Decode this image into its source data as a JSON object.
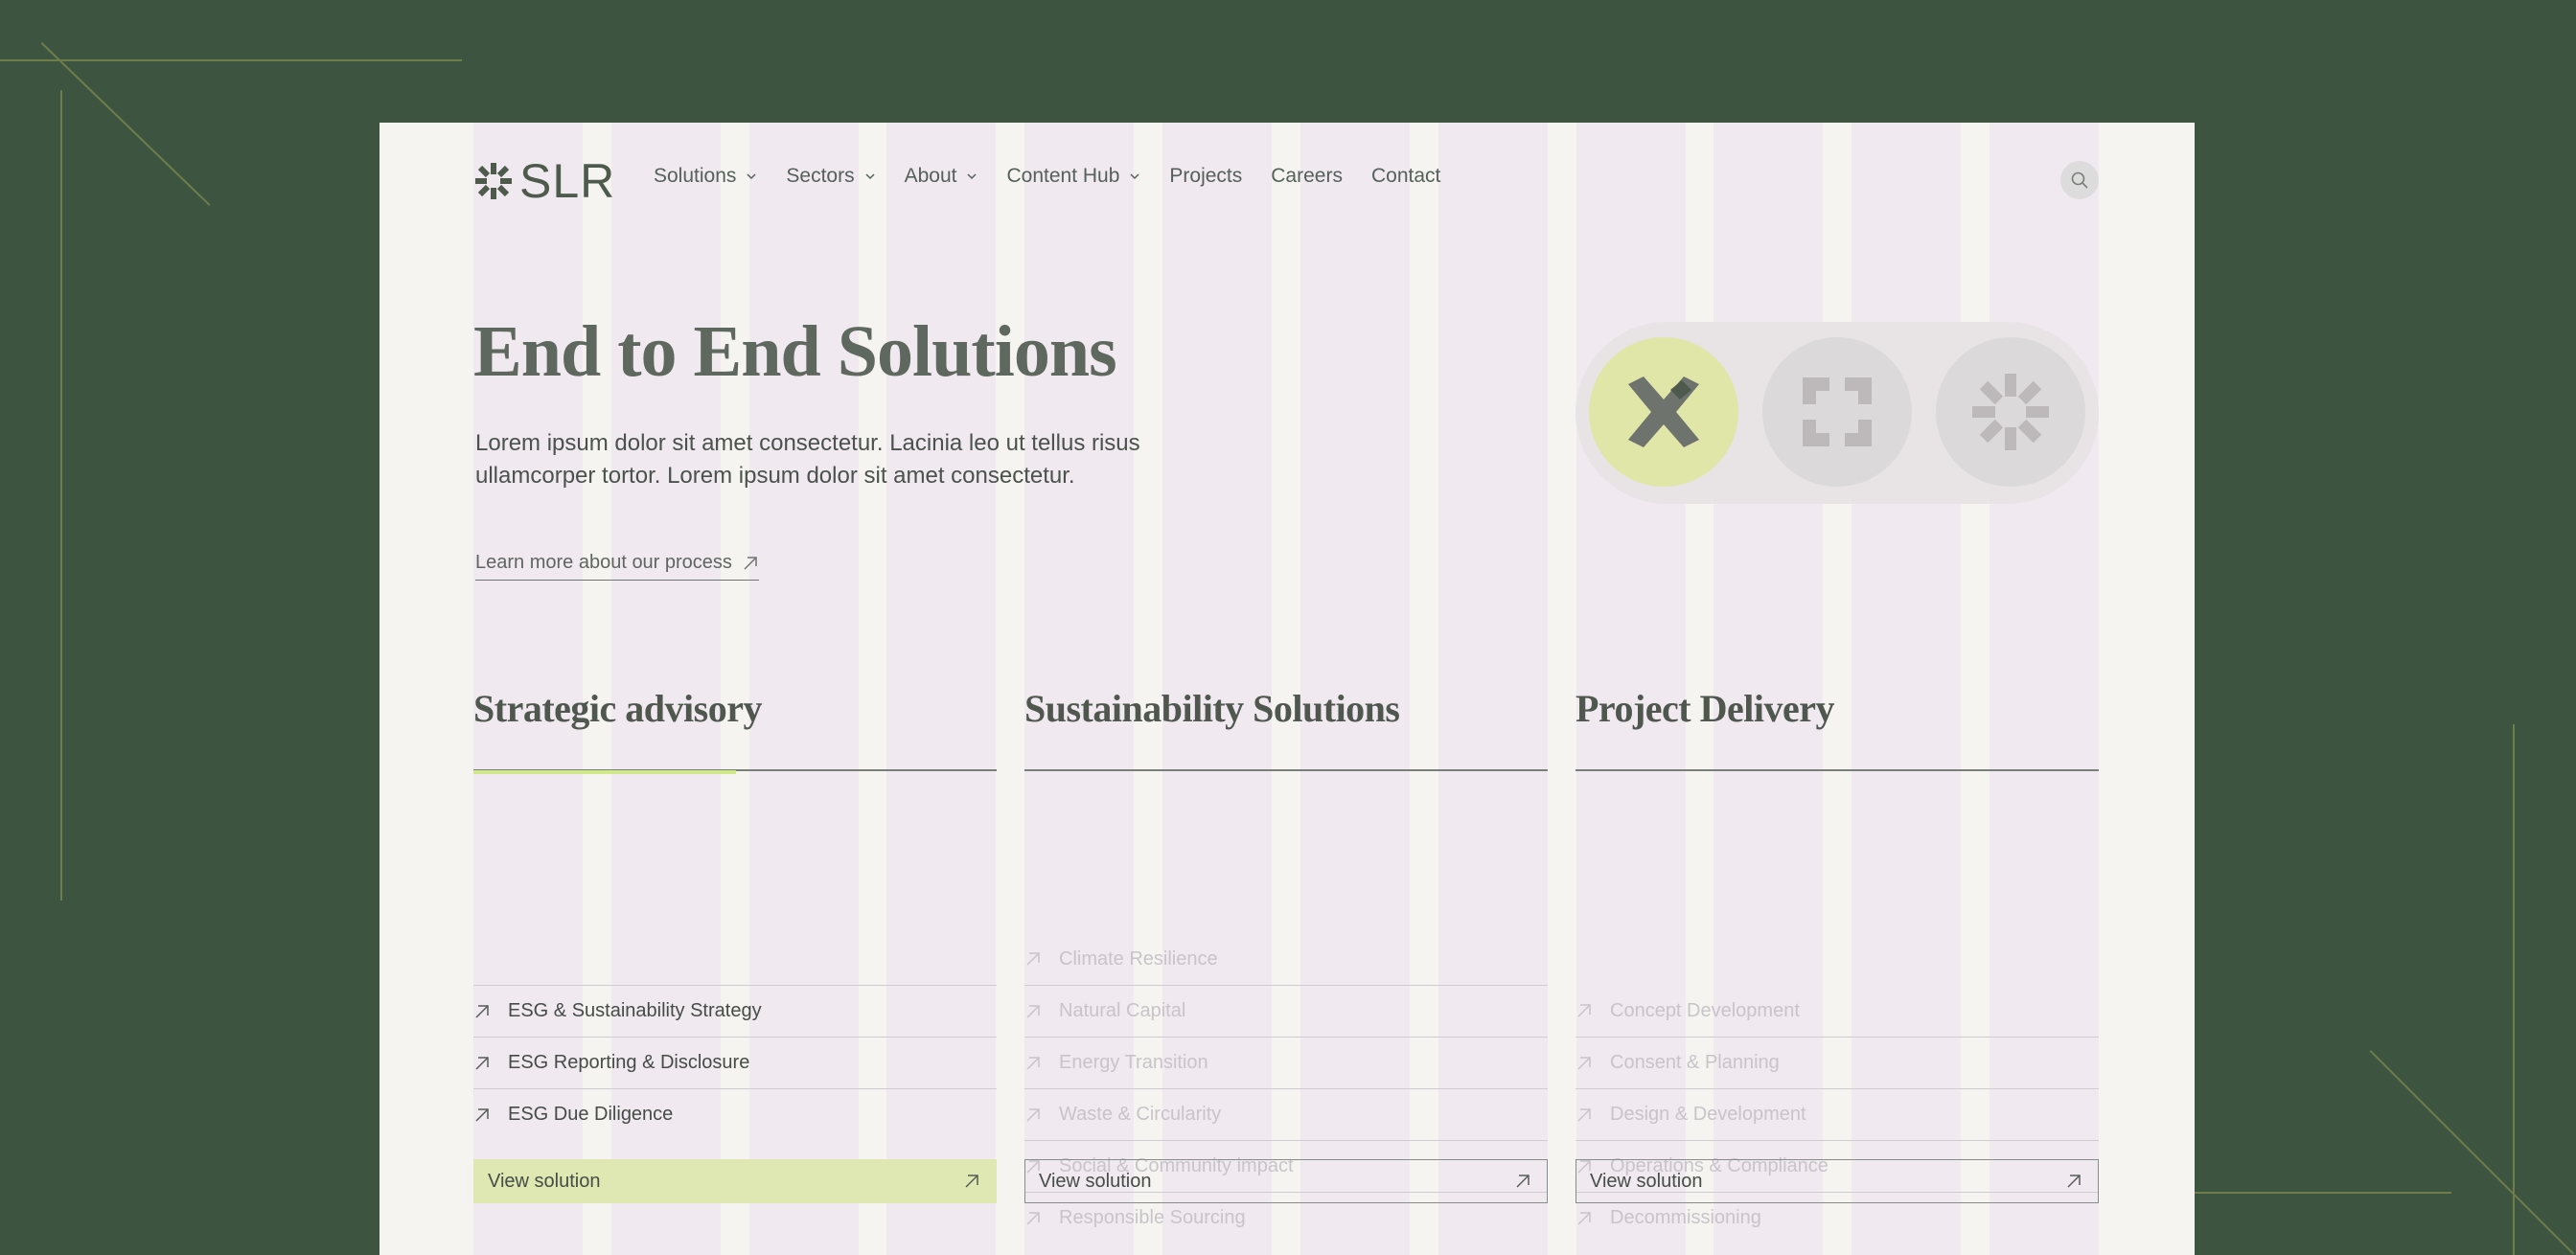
{
  "brand": {
    "name": "SLR",
    "accent": "#cfe88a",
    "background": "#3d5540"
  },
  "nav": {
    "items": [
      {
        "label": "Solutions",
        "dropdown": true
      },
      {
        "label": "Sectors",
        "dropdown": true
      },
      {
        "label": "About",
        "dropdown": true
      },
      {
        "label": "Content Hub",
        "dropdown": true
      },
      {
        "label": "Projects",
        "dropdown": false
      },
      {
        "label": "Careers",
        "dropdown": false
      },
      {
        "label": "Contact",
        "dropdown": false
      }
    ],
    "search_icon": "search-icon"
  },
  "hero": {
    "title": "End to End Solutions",
    "description": "Lorem ipsum dolor sit amet consectetur. Lacinia leo ut tellus risus ullamcorper tortor. Lorem ipsum dolor sit amet consectetur.",
    "link": "Learn more about our process"
  },
  "switcher": {
    "icons": [
      "cross-arrows-icon",
      "square-frame-icon",
      "asterisk-icon"
    ],
    "active": 0
  },
  "solutions": [
    {
      "title": "Strategic advisory",
      "items": [
        "ESG & Sustainability Strategy",
        "ESG Reporting & Disclosure",
        "ESG Due Diligence"
      ],
      "button": "View solution"
    },
    {
      "title": "Sustainability Solutions",
      "items": [
        "Climate Resilience",
        "Natural Capital",
        "Energy Transition",
        "Waste & Circularity",
        "Social & Community impact",
        "Responsible Sourcing"
      ],
      "button": "View solution"
    },
    {
      "title": "Project Delivery",
      "items": [
        "Concept Development",
        "Consent & Planning",
        "Design & Development",
        "Operations & Compliance",
        "Decommissioning"
      ],
      "button": "View solution"
    }
  ]
}
